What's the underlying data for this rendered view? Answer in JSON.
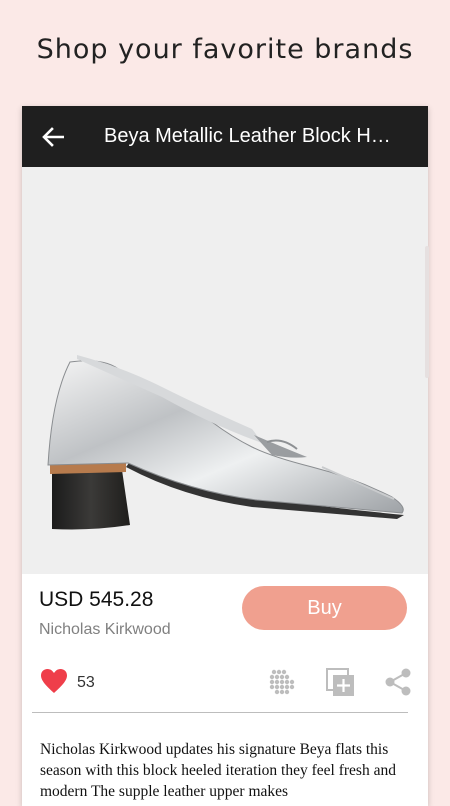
{
  "headline": "Shop your favorite brands",
  "appbar": {
    "title": "Beya Metallic Leather Block H…",
    "back_icon": "arrow-left-icon"
  },
  "product": {
    "image_alt": "Silver metallic leather block-heel loafer",
    "price": "USD 545.28",
    "brand": "Nicholas Kirkwood",
    "buy_label": "Buy"
  },
  "actions": {
    "likes": "53",
    "icons": [
      "heart-icon",
      "lookbook-icon",
      "add-to-collection-icon",
      "share-icon"
    ]
  },
  "description": "Nicholas Kirkwood updates his signature Beya flats this season with this block heeled iteration they feel fresh and modern The supple leather upper makes",
  "colors": {
    "background": "#fbe9e7",
    "appbar": "#1f1f1f",
    "buy_button": "#f0a08f",
    "heart": "#ef3e4a"
  }
}
